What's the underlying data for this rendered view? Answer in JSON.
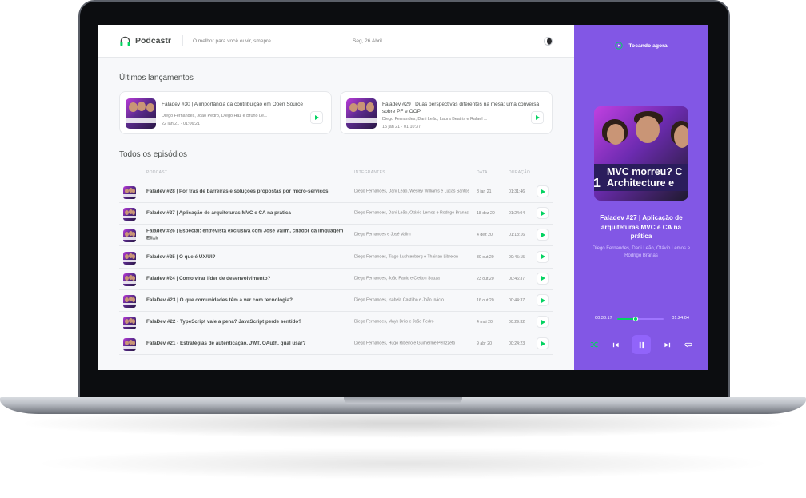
{
  "app": {
    "name": "Podcastr",
    "tagline": "O melhor para você ouvir, smepre",
    "date": "Seg, 26 Abril"
  },
  "colors": {
    "accent": "#8257e5",
    "play_green": "#04d361",
    "text": "#494d4b",
    "muted": "#808080"
  },
  "latest": {
    "title": "Últimos lançamentos",
    "items": [
      {
        "title": "Faladev #30 | A importância da contribuição em Open Source",
        "members": "Diego Fernandes, João Pedro, Diego Haz e Bruno Le...",
        "date": "22 jan 21",
        "duration": "01:06:21"
      },
      {
        "title": "Faladev #29 | Duas perspectivas diferentes na mesa: uma conversa sobre PF e OOP",
        "members": "Diego Fernandes, Dani Leão, Laura Beatris e Rafael ...",
        "date": "15 jan 21",
        "duration": "01:10:37"
      }
    ]
  },
  "episodes": {
    "title": "Todos os episódios",
    "columns": {
      "podcast": "PODCAST",
      "members": "INTEGRANTES",
      "date": "DATA",
      "duration": "DURAÇÃO"
    },
    "rows": [
      {
        "title": "Faladev #28 | Por trás de barreiras e soluções propostas por micro-serviços",
        "members": "Diego Fernandes, Dani Leão, Wesley Williams e Lucas Santos",
        "date": "8 jan 21",
        "duration": "01:31:46"
      },
      {
        "title": "Faladev #27 | Aplicação de arquiteturas MVC e CA na prática",
        "members": "Diego Fernandes, Dani Leão, Otávio Lemos e Rodrigo Branas",
        "date": "18 dez 20",
        "duration": "01:24:04"
      },
      {
        "title": "Faladev #26 | Especial: entrevista exclusiva com José Valim, criador da linguagem Elixir",
        "members": "Diego Fernandes e José Valim",
        "date": "4 dez 20",
        "duration": "01:13:16"
      },
      {
        "title": "Faladev #25 | O que é UX/UI?",
        "members": "Diego Fernandes, Tiago Luchtenberg e Thainan Librelon",
        "date": "30 out 20",
        "duration": "00:45:15"
      },
      {
        "title": "Faladev #24 | Como virar líder de desenvolvimento?",
        "members": "Diego Fernandes, João Paulo e Cleiton Souza",
        "date": "23 out 20",
        "duration": "00:46:37"
      },
      {
        "title": "FalaDev #23 | O que comunidades têm a ver com tecnologia?",
        "members": "Diego Fernandes, Isabela Castilho e João Inácio",
        "date": "16 out 20",
        "duration": "00:44:37"
      },
      {
        "title": "FalaDev #22 - TypeScript vale a pena? JavaScript perde sentido?",
        "members": "Diego Fernandes, Mayk Brito e João Pedro",
        "date": "4 mai 20",
        "duration": "00:29:32"
      },
      {
        "title": "FalaDev #21 - Estratégias de autenticação, JWT, OAuth, qual usar?",
        "members": "Diego Fernandes, Hugo Ribeiro e Guilherme Pellizzetti",
        "date": "9 abr 20",
        "duration": "00:24:23"
      }
    ]
  },
  "player": {
    "label": "Tocando agora",
    "cover_text": "MVC morreu? C\nArchitecture e",
    "cover_number": "1",
    "title": "Faladev #27 | Aplicação de arquiteturas MVC e CA na prática",
    "members": "Diego Fernandes, Dani Leão, Otávio Lemos e Rodrigo Branas",
    "current_time": "00:33:17",
    "total_time": "01:24:04",
    "progress": 0.4
  },
  "icons": {
    "logo": "headphones-icon",
    "theme": "moon-icon",
    "now_playing": "play-circle-icon",
    "shuffle": "shuffle-icon",
    "previous": "skip-back-icon",
    "pause": "pause-icon",
    "next": "skip-forward-icon",
    "repeat": "repeat-icon",
    "play": "play-icon"
  }
}
